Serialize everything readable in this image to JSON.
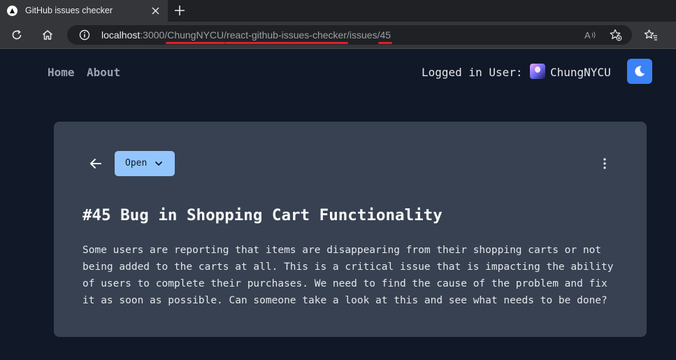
{
  "browser": {
    "tab_title": "GitHub issues checker",
    "url_host": "localhost",
    "url_port": ":3000",
    "url_sep1": "/",
    "url_owner": "ChungNYCU",
    "url_sep2": "/",
    "url_repo": "react-github-issues-checker",
    "url_issues": "/issues/",
    "url_number": "45"
  },
  "nav": {
    "home": "Home",
    "about": "About",
    "logged_in_label": "Logged in User:",
    "username": "ChungNYCU"
  },
  "issue": {
    "status": "Open",
    "title": "#45 Bug in Shopping Cart Functionality",
    "body_lines": [
      "Some users are reporting that items are disappearing from their shopping carts or not",
      "being added to the carts at all. This is a critical issue that is impacting the ability",
      "of users to complete their purchases. We need to find the cause of the problem and fix",
      "it as soon as possible. Can someone take a look at this and see what needs to be done?"
    ]
  },
  "colors": {
    "page_bg": "#111827",
    "card_bg": "#374151",
    "accent": "#3b82f6",
    "status_bg": "#93c5fd",
    "underline": "#e11d2c"
  }
}
